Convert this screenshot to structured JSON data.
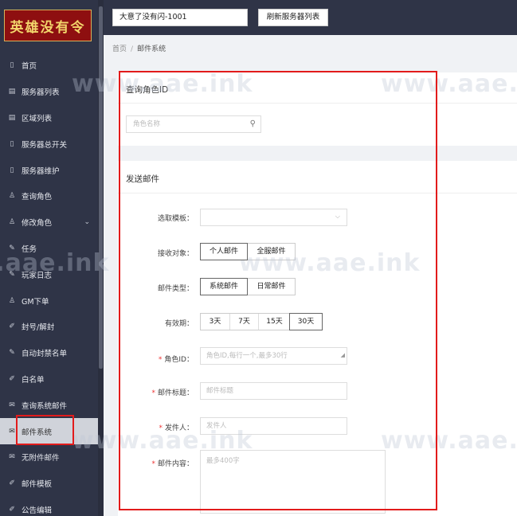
{
  "logo": {
    "text": "英雄没有令"
  },
  "header": {
    "server_select": "大意了没有闪-1001",
    "refresh_label": "刷新服务器列表"
  },
  "breadcrumb": {
    "home": "首页",
    "separator": "/",
    "current": "邮件系统"
  },
  "sidebar": {
    "items": [
      {
        "label": "首页",
        "icon": "▯"
      },
      {
        "label": "服务器列表",
        "icon": "▤"
      },
      {
        "label": "区域列表",
        "icon": "▤"
      },
      {
        "label": "服务器总开关",
        "icon": "▯"
      },
      {
        "label": "服务器维护",
        "icon": "▯"
      },
      {
        "label": "查询角色",
        "icon": "♙"
      },
      {
        "label": "修改角色",
        "icon": "♙",
        "chevron": "⌄"
      },
      {
        "label": "任务",
        "icon": "✎"
      },
      {
        "label": "玩家日志",
        "icon": "✎"
      },
      {
        "label": "GM下单",
        "icon": "♙"
      },
      {
        "label": "封号/解封",
        "icon": "✐"
      },
      {
        "label": "自动封禁名单",
        "icon": "✎"
      },
      {
        "label": "白名单",
        "icon": "✐"
      },
      {
        "label": "查询系统邮件",
        "icon": "✉"
      },
      {
        "label": "邮件系统",
        "icon": "✉",
        "active": true
      },
      {
        "label": "无附件邮件",
        "icon": "✉"
      },
      {
        "label": "邮件模板",
        "icon": "✐"
      },
      {
        "label": "公告编辑",
        "icon": "✐"
      }
    ]
  },
  "query_role": {
    "title": "查询角色ID",
    "search_placeholder": "角色名称",
    "search_icon": "⚲"
  },
  "send_mail": {
    "title": "发送邮件",
    "template_label": "选取模板：",
    "target_label": "接收对象：",
    "target_options": [
      "个人邮件",
      "全服邮件"
    ],
    "type_label": "邮件类型：",
    "type_options": [
      "系统邮件",
      "日常邮件"
    ],
    "validity_label": "有效期：",
    "validity_options": [
      "3天",
      "7天",
      "15天",
      "30天"
    ],
    "required_mark": "*",
    "role_id_label": "角色ID：",
    "role_id_placeholder": "角色ID,每行一个,最多30行",
    "subject_label": "邮件标题：",
    "subject_placeholder": "邮件标题",
    "sender_label": "发件人：",
    "sender_placeholder": "发件人",
    "content_label": "邮件内容：",
    "content_placeholder": "最多400字"
  },
  "watermark": "www.aae.ink",
  "colors": {
    "sidebar_bg": "#2f3447",
    "annotation_red": "#e21b1b",
    "logo_bg": "#8e0f10",
    "logo_text": "#f2d56b"
  }
}
